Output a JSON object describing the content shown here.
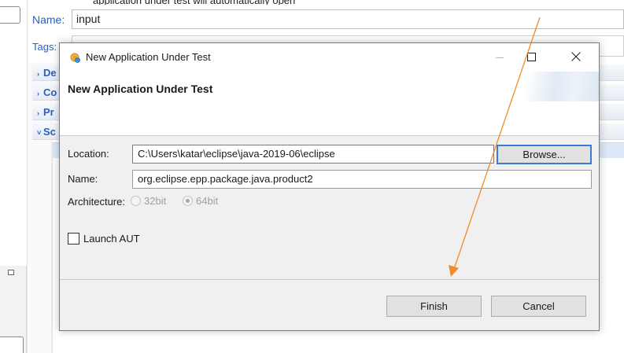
{
  "background": {
    "top_text": "application under test will automatically open",
    "name_label": "Name:",
    "name_value": "input",
    "tags_label": "Tags:",
    "sections": [
      {
        "label": "De",
        "expanded": false
      },
      {
        "label": "Co",
        "expanded": false
      },
      {
        "label": "Pr",
        "expanded": false
      },
      {
        "label": "Sc",
        "expanded": true
      }
    ]
  },
  "dialog": {
    "window_title": "New Application Under Test",
    "header_title": "New Application Under Test",
    "location_label": "Location:",
    "location_value": "C:\\Users\\katar\\eclipse\\java-2019-06\\eclipse",
    "browse_label": "Browse...",
    "name_label": "Name:",
    "name_value": "org.eclipse.epp.package.java.product2",
    "architecture_label": "Architecture:",
    "arch_options": [
      {
        "label": "32bit",
        "selected": false,
        "enabled": false
      },
      {
        "label": "64bit",
        "selected": true,
        "enabled": false
      }
    ],
    "launch_aut_label": "Launch AUT",
    "launch_aut_checked": false,
    "finish_label": "Finish",
    "cancel_label": "Cancel"
  },
  "icons": {
    "app_icon": "eclipse-aut-icon",
    "minimize": "minimize-icon",
    "maximize": "maximize-icon",
    "close": "close-icon"
  },
  "colors": {
    "accent_blue": "#2a5ec0",
    "focus_border": "#3a7bd5",
    "annotation_arrow": "#f08a2c"
  }
}
